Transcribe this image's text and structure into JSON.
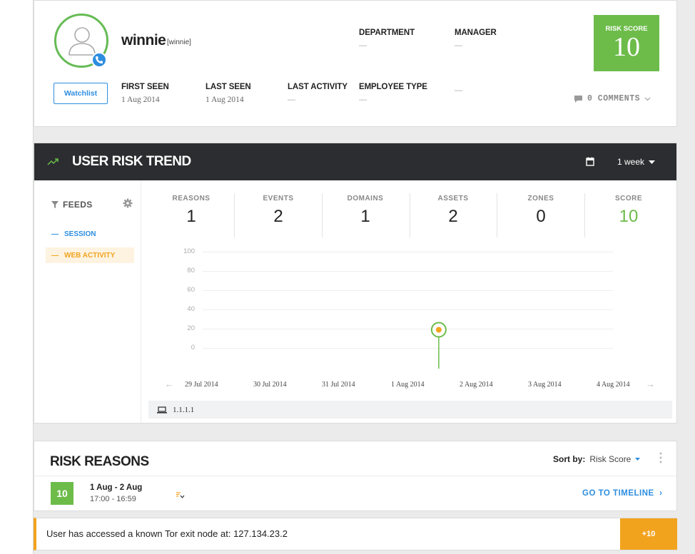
{
  "profile": {
    "username": "winnie",
    "handle": "[winnie]",
    "department_label": "DEPARTMENT",
    "department_value": "—",
    "manager_label": "MANAGER",
    "manager_value": "—",
    "first_seen_label": "FIRST SEEN",
    "first_seen_value": "1 Aug 2014",
    "last_seen_label": "LAST SEEN",
    "last_seen_value": "1 Aug 2014",
    "last_activity_label": "LAST ACTIVITY",
    "last_activity_value": "—",
    "employee_type_label": "EMPLOYEE TYPE",
    "employee_type_value": "—",
    "extra_value": "—",
    "watchlist_label": "Watchlist",
    "risk_score_label": "RISK SCORE",
    "risk_score_value": "10",
    "comments_label": "0 COMMENTS",
    "avatar_color": "#66bb55",
    "badge_color": "#2d8ee0"
  },
  "trend": {
    "title": "USER RISK TREND",
    "range_label": "1 week",
    "feeds_label": "FEEDS",
    "feeds": [
      {
        "label": "SESSION",
        "color": "#2d8ee0"
      },
      {
        "label": "WEB ACTIVITY",
        "color": "#f2a31e"
      }
    ],
    "metrics": [
      {
        "label": "REASONS",
        "value": "1"
      },
      {
        "label": "EVENTS",
        "value": "2"
      },
      {
        "label": "DOMAINS",
        "value": "1"
      },
      {
        "label": "ASSETS",
        "value": "2"
      },
      {
        "label": "ZONES",
        "value": "0"
      },
      {
        "label": "SCORE",
        "value": "10"
      }
    ],
    "ip_label": "1.1.1.1"
  },
  "chart_data": {
    "type": "scatter",
    "categories": [
      "29 Jul 2014",
      "30 Jul 2014",
      "31 Jul 2014",
      "1 Aug 2014",
      "2 Aug 2014",
      "3 Aug 2014",
      "4 Aug 2014"
    ],
    "y_ticks": [
      "100",
      "80",
      "60",
      "40",
      "20",
      "0"
    ],
    "ylim": [
      0,
      100
    ],
    "series": [
      {
        "points": [
          {
            "x": "1 Aug 2014",
            "y": 10
          }
        ],
        "color": "#f2a31e",
        "ring_color": "#6dbc4a"
      }
    ],
    "grid": true
  },
  "reasons": {
    "title": "RISK REASONS",
    "sort_label": "Sort by:",
    "sort_value": "Risk Score",
    "items": [
      {
        "score": "10",
        "date_range": "1 Aug - 2 Aug",
        "time_range": "17:00 - 16:59",
        "link": "GO TO TIMELINE"
      }
    ]
  },
  "alert": {
    "message": "User has accessed a known Tor exit node at: 127.134.23.2",
    "points": "+10"
  }
}
